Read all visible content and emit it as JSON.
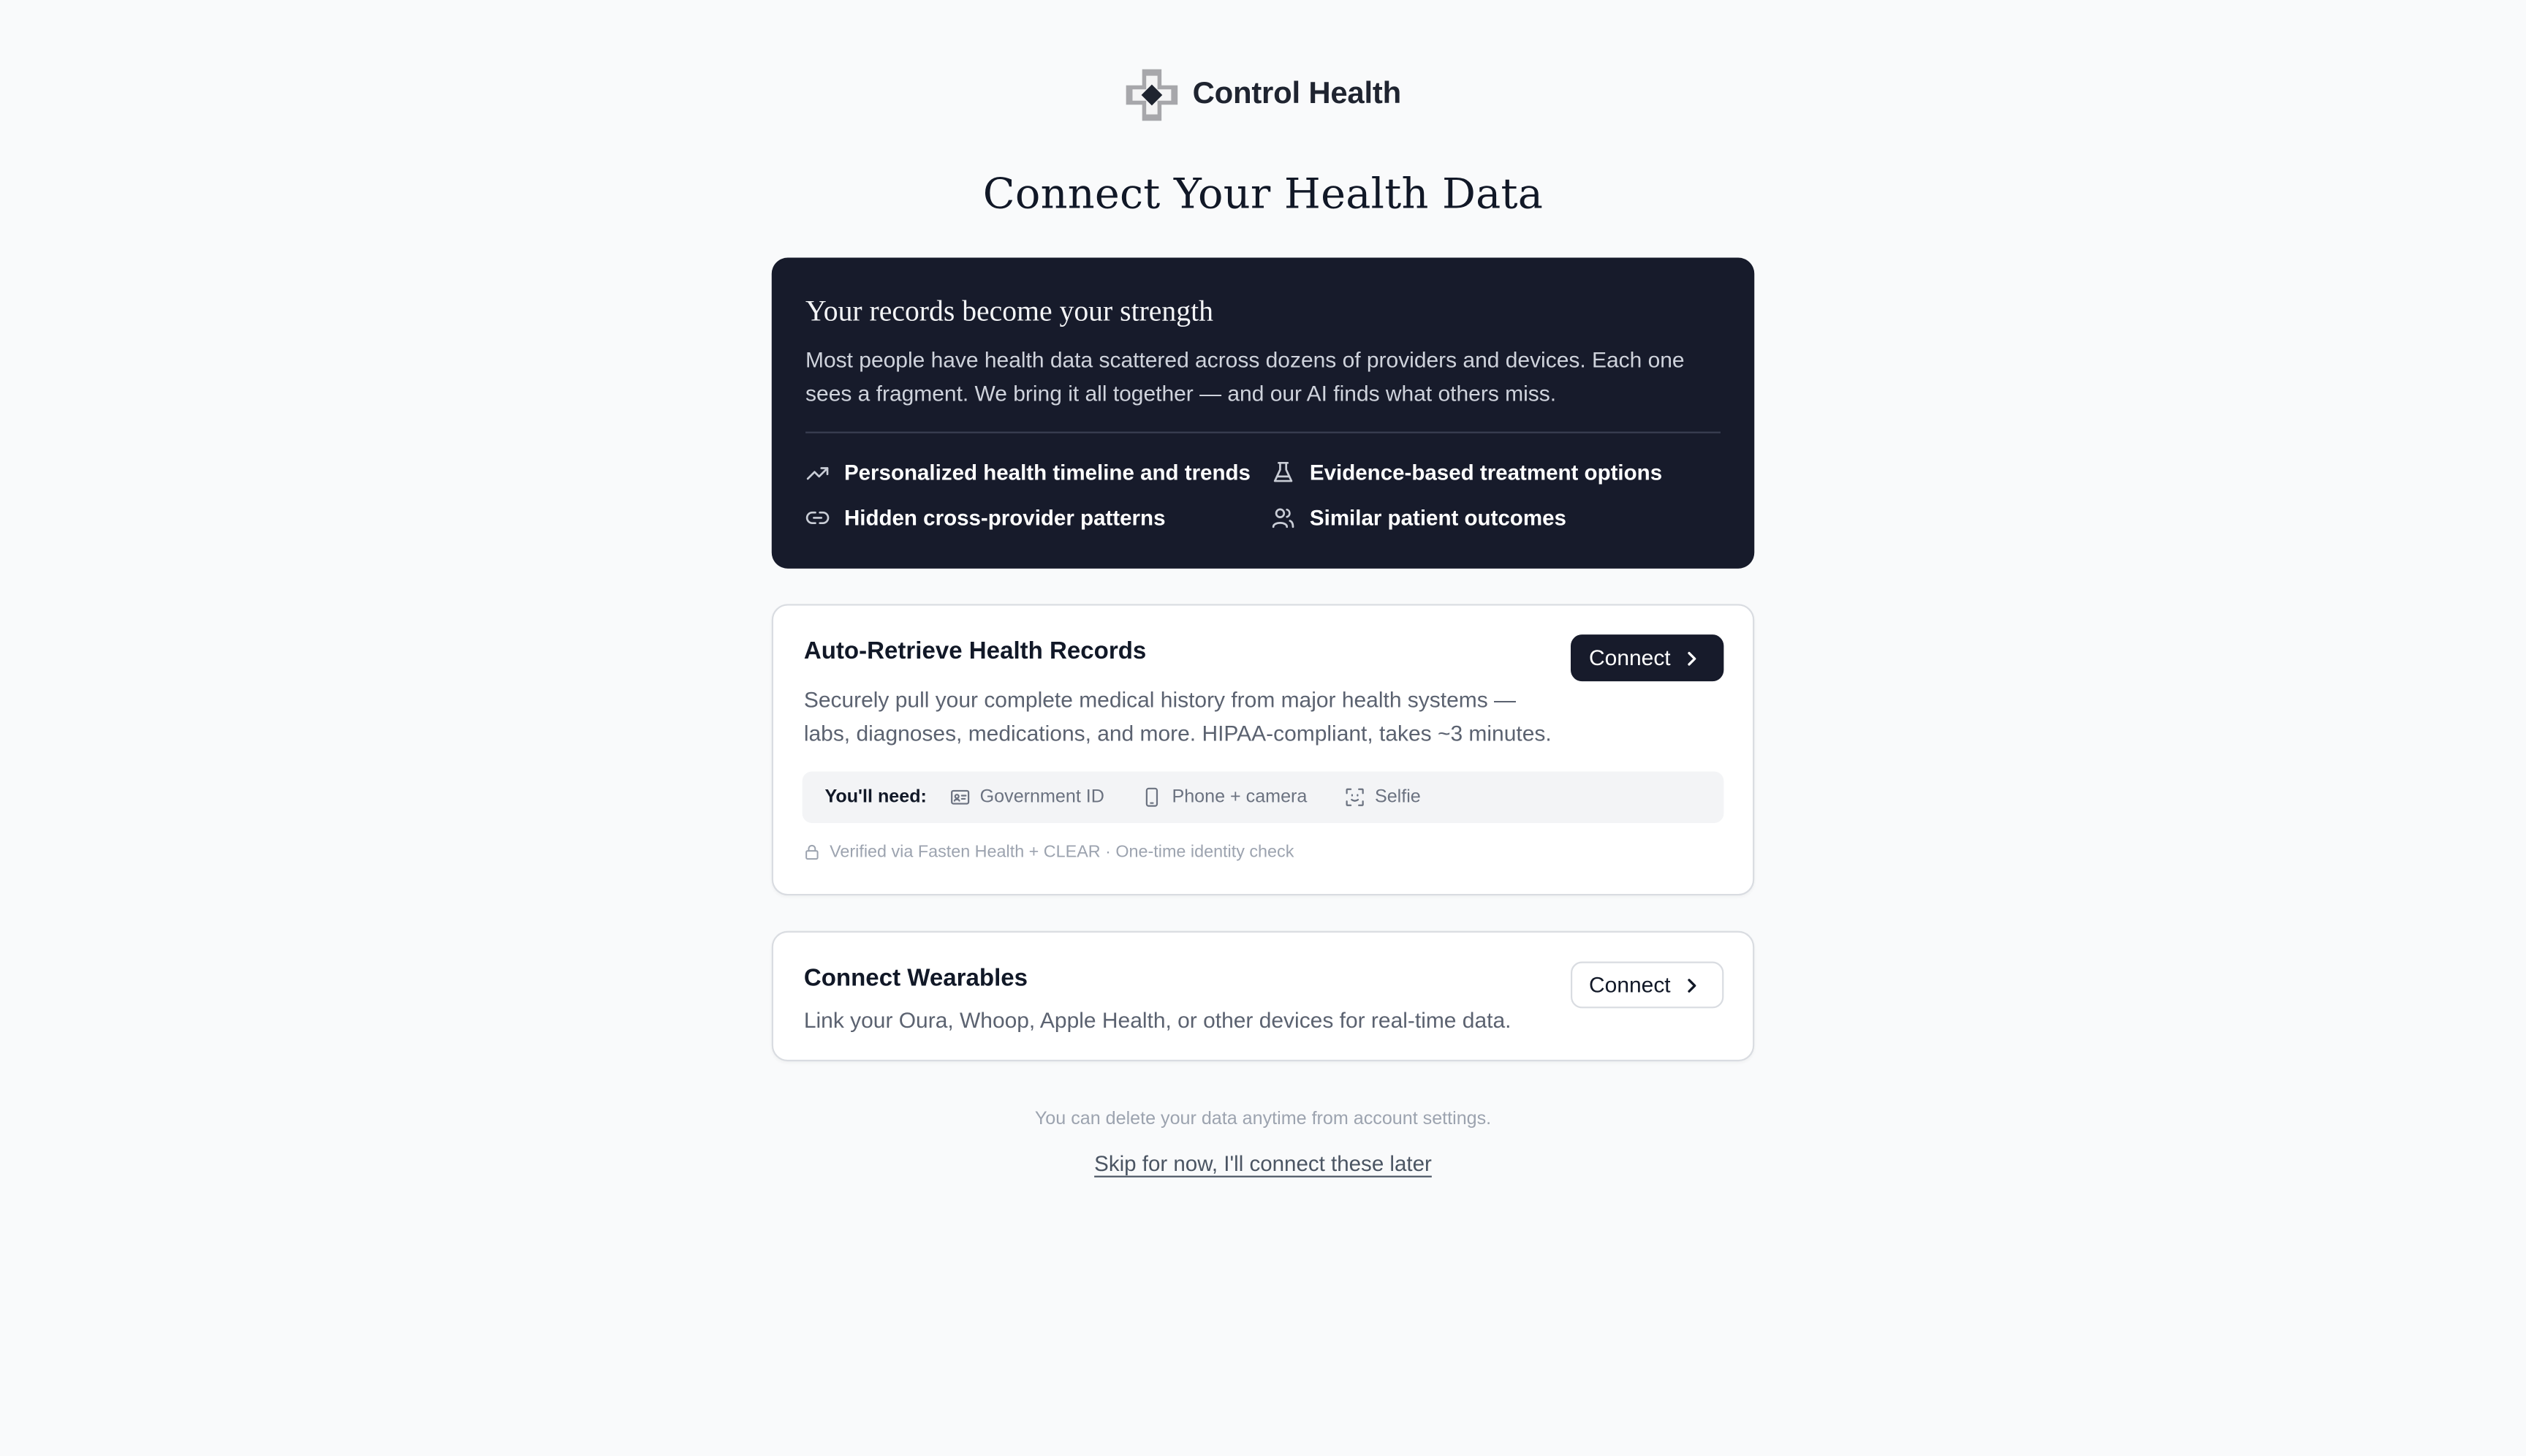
{
  "brand": {
    "name": "Control Health",
    "icon": "cross-logo-icon",
    "accent": "#171b2b"
  },
  "page": {
    "title": "Connect Your Health Data"
  },
  "hero": {
    "title": "Your records become your strength",
    "body": "Most people have health data scattered across dozens of providers and devices. Each one sees a fragment. We bring it all together — and our AI finds what others miss.",
    "features": [
      {
        "icon": "trending-up-icon",
        "label": "Personalized health timeline and trends"
      },
      {
        "icon": "flask-icon",
        "label": "Evidence-based treatment options"
      },
      {
        "icon": "link-icon",
        "label": "Hidden cross-provider patterns"
      },
      {
        "icon": "users-icon",
        "label": "Similar patient outcomes"
      }
    ]
  },
  "records_card": {
    "title": "Auto-Retrieve Health Records",
    "description": "Securely pull your complete medical history from major health systems — labs, diagnoses, medications, and more. HIPAA-compliant, takes ~3 minutes.",
    "connect_label": "Connect",
    "needs_label": "You'll need:",
    "needs": [
      {
        "icon": "id-card-icon",
        "label": "Government ID"
      },
      {
        "icon": "phone-icon",
        "label": "Phone + camera"
      },
      {
        "icon": "face-scan-icon",
        "label": "Selfie"
      }
    ],
    "verified_note": "Verified via Fasten Health + CLEAR · One-time identity check"
  },
  "wearables_card": {
    "title": "Connect Wearables",
    "description": "Link your Oura, Whoop, Apple Health, or other devices for real-time data.",
    "connect_label": "Connect"
  },
  "footer": {
    "note": "You can delete your data anytime from account settings.",
    "skip_label": "Skip for now, I'll connect these later"
  }
}
